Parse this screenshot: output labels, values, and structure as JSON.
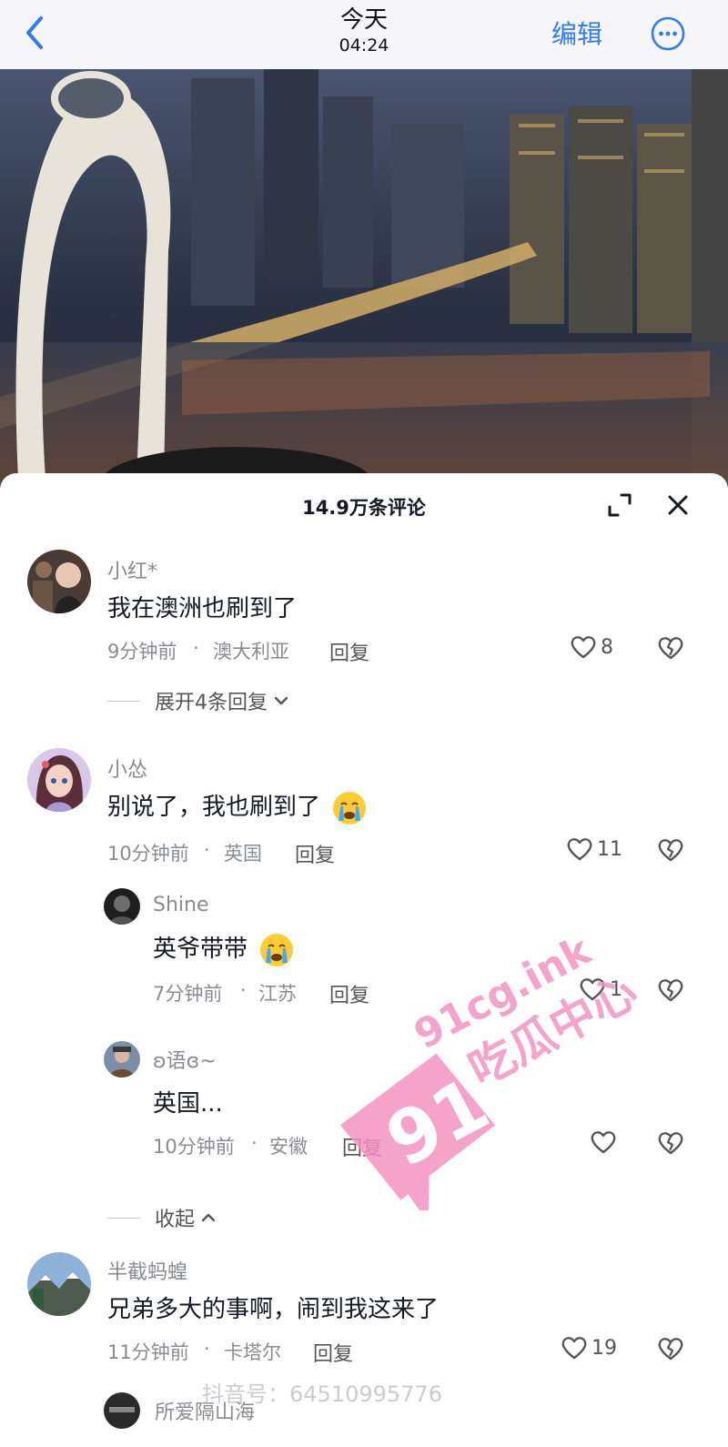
{
  "nav": {
    "title": "今天",
    "time": "04:24",
    "edit_label": "编辑",
    "back_icon": "chevron-left-icon",
    "more_icon": "more-circle-icon"
  },
  "sheet": {
    "title": "14.9万条评论"
  },
  "comments": [
    {
      "username": "小红*",
      "text": "我在澳洲也刷到了",
      "time": "9分钟前",
      "location": "澳大利亚",
      "reply_label": "回复",
      "likes": "8",
      "expand_label": "展开4条回复"
    },
    {
      "username": "小怂",
      "text": "别说了，我也刷到了",
      "time": "10分钟前",
      "location": "英国",
      "reply_label": "回复",
      "likes": "11",
      "replies": [
        {
          "username": "Shine",
          "text": "英爷带带",
          "time": "7分钟前",
          "location": "江苏",
          "reply_label": "回复",
          "likes": "1"
        },
        {
          "username": "ʚ语ɞ~",
          "text": "英国...",
          "time": "10分钟前",
          "location": "安徽",
          "reply_label": "回复",
          "likes": ""
        }
      ],
      "collapse_label": "收起"
    },
    {
      "username": "半截蚂蝗",
      "text": "兄弟多大的事啊，闹到我这来了",
      "time": "11分钟前",
      "location": "卡塔尔",
      "reply_label": "回复",
      "likes": "19"
    },
    {
      "username": "所爱隔山海"
    }
  ],
  "separator": "·",
  "watermark": {
    "badge": "91",
    "site": "91cg.ink",
    "name": "吃瓜中心",
    "douyin_id": "抖音号：64510995776"
  },
  "colors": {
    "accent": "#2f7cf6",
    "watermark_pink": "#f58fc0"
  }
}
